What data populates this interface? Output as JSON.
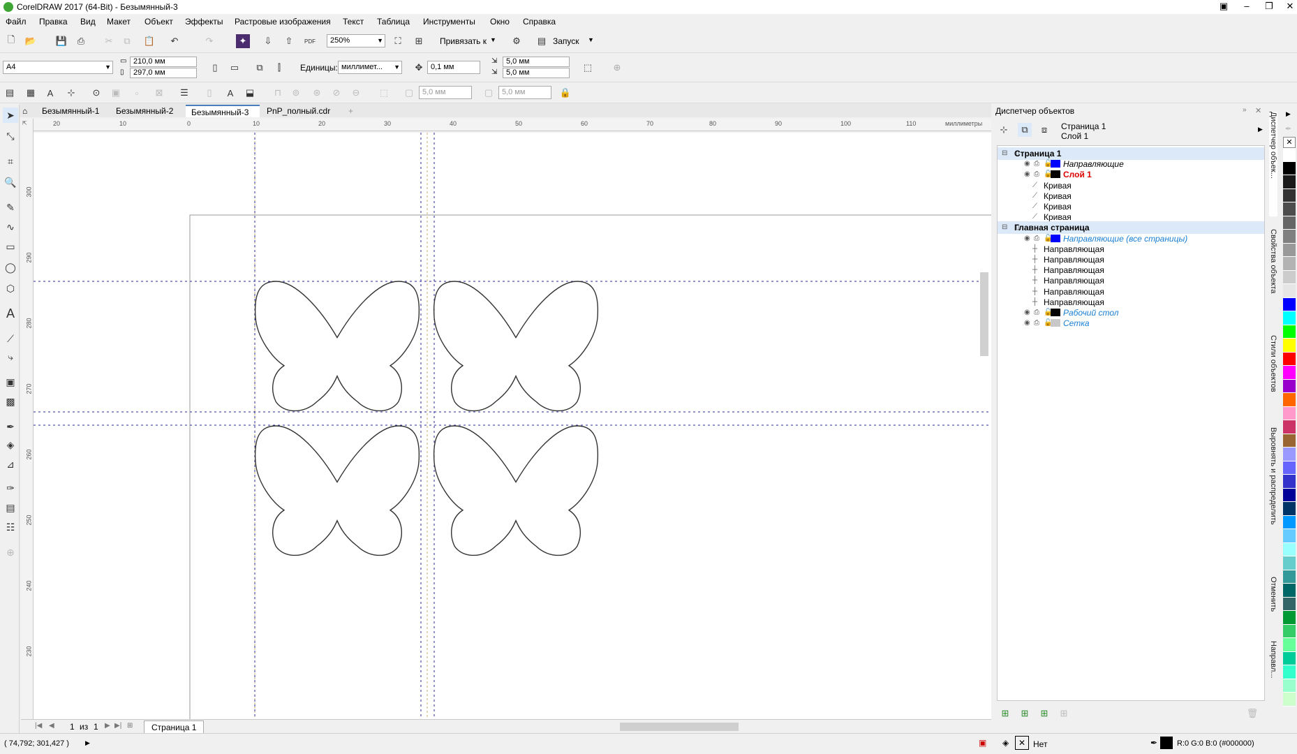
{
  "window": {
    "title": "CorelDRAW 2017 (64-Bit) - Безымянный-3"
  },
  "menu": [
    "Файл",
    "Правка",
    "Вид",
    "Макет",
    "Объект",
    "Эффекты",
    "Растровые изображения",
    "Текст",
    "Таблица",
    "Инструменты",
    "Окно",
    "Справка"
  ],
  "standard_toolbar": {
    "zoom": "250%",
    "snap_label": "Привязать к",
    "launch_label": "Запуск",
    "pdf_label": "PDF"
  },
  "property_bar": {
    "page_size": "A4",
    "width": "210,0 мм",
    "height": "297,0 мм",
    "units_label": "Единицы:",
    "units_value": "миллимет...",
    "nudge": "0,1 мм",
    "dup_x": "5,0 мм",
    "dup_y": "5,0 мм"
  },
  "third_bar": {
    "field1": "5,0 мм",
    "field2": "5,0 мм"
  },
  "doc_tabs": [
    "Безымянный-1",
    "Безымянный-2",
    "Безымянный-3",
    "PnP_полный.cdr"
  ],
  "active_tab": "Безымянный-3",
  "ruler": {
    "h_ticks": [
      "20",
      "10",
      "0",
      "10",
      "20",
      "30",
      "40",
      "50",
      "60",
      "70",
      "80",
      "90",
      "100",
      "110"
    ],
    "h_units": "миллиметры",
    "v_ticks": [
      "300",
      "290",
      "280",
      "270",
      "260",
      "250",
      "240",
      "230"
    ]
  },
  "page_nav": {
    "current": "1",
    "of": "из",
    "total": "1",
    "page_tab": "Страница 1"
  },
  "status": {
    "coords": "( 74,792; 301,427 )",
    "fill_label": "Нет",
    "outline_color": "R:0 G:0 B:0 (#000000)"
  },
  "docker": {
    "title": "Диспетчер объектов",
    "crumb_page": "Страница 1",
    "crumb_layer": "Слой 1",
    "tree": [
      {
        "text": "Страница 1",
        "style": "page",
        "indent": 0
      },
      {
        "text": "Направляющие",
        "style": "italic",
        "indent": 1,
        "color": "#0000ff"
      },
      {
        "text": "Слой 1",
        "style": "red",
        "indent": 1,
        "color": "#000000"
      },
      {
        "text": "Кривая",
        "style": "item",
        "indent": 2
      },
      {
        "text": "Кривая",
        "style": "item",
        "indent": 2
      },
      {
        "text": "Кривая",
        "style": "item",
        "indent": 2
      },
      {
        "text": "Кривая",
        "style": "item",
        "indent": 2
      },
      {
        "text": "Главная страница",
        "style": "page",
        "indent": 0
      },
      {
        "text": "Направляющие (все страницы)",
        "style": "blue",
        "indent": 1,
        "color": "#0000ff"
      },
      {
        "text": "Направляющая",
        "style": "item",
        "indent": 2
      },
      {
        "text": "Направляющая",
        "style": "item",
        "indent": 2
      },
      {
        "text": "Направляющая",
        "style": "item",
        "indent": 2
      },
      {
        "text": "Направляющая",
        "style": "item",
        "indent": 2
      },
      {
        "text": "Направляющая",
        "style": "item",
        "indent": 2
      },
      {
        "text": "Направляющая",
        "style": "item",
        "indent": 2
      },
      {
        "text": "Рабочий стол",
        "style": "blue",
        "indent": 1,
        "color": "#000000"
      },
      {
        "text": "Сетка",
        "style": "blue",
        "indent": 1,
        "color": "#c8c8c8"
      }
    ]
  },
  "side_tabs": [
    "Диспетчер объек...",
    "Свойства объекта",
    "Стили объектов",
    "Выровнять и распределить",
    "Отменить",
    "Направл..."
  ],
  "palette": [
    "#ffffff",
    "#000000",
    "#1a1a1a",
    "#333333",
    "#4d4d4d",
    "#666666",
    "#808080",
    "#999999",
    "#b3b3b3",
    "#cccccc",
    "#e6e6e6",
    "#0000ff",
    "#00ffff",
    "#00ff00",
    "#ffff00",
    "#ff0000",
    "#ff00ff",
    "#9900cc",
    "#ff6600",
    "#ff99cc",
    "#cc3366",
    "#996633",
    "#9999ff",
    "#6666ff",
    "#3333cc",
    "#000099",
    "#003366",
    "#0099ff",
    "#66ccff",
    "#99ffff",
    "#66cccc",
    "#339999",
    "#006666",
    "#336666",
    "#009933",
    "#33cc66",
    "#66ff99",
    "#00cc99",
    "#33ffcc",
    "#99ffcc",
    "#ccffcc"
  ]
}
